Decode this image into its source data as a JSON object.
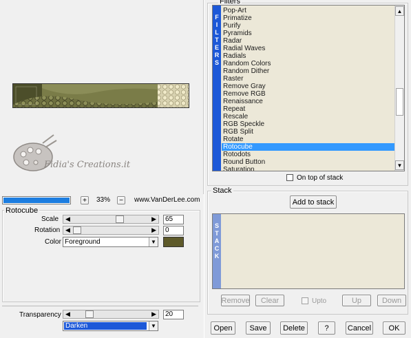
{
  "preview": {
    "zoom_value": "33%",
    "zoom_plus_label": "+",
    "zoom_minus_label": "−",
    "website": "www.VanDerLee.com",
    "watermark_text": "Fidia's Creations.it"
  },
  "filters": {
    "group_title": "Filters",
    "vertical_label": [
      "F",
      "I",
      "L",
      "T",
      "E",
      "R",
      "S"
    ],
    "items": [
      "Pop-Art",
      "Primatize",
      "Purify",
      "Pyramids",
      "Radar",
      "Radial Waves",
      "Radials",
      "Random Colors",
      "Random Dither",
      "Raster",
      "Remove Gray",
      "Remove RGB",
      "Renaissance",
      "Repeat",
      "Rescale",
      "RGB Speckle",
      "RGB Split",
      "Rotate",
      "Rotocube",
      "Rotodots",
      "Round Button",
      "Saturation"
    ],
    "selected_index": 18,
    "on_top_label": "On top of stack",
    "scroll_position": 0.72
  },
  "params": {
    "group_title": "Rotocube",
    "scale_label": "Scale",
    "scale_value": "65",
    "scale_fraction": 0.58,
    "rotation_label": "Rotation",
    "rotation_value": "0",
    "rotation_fraction": 0.0,
    "color_label": "Color",
    "color_value": "Foreground",
    "color_swatch": "#5e5a2a"
  },
  "transparency": {
    "label": "Transparency",
    "value": "20",
    "fraction": 0.2,
    "blend_mode": "Darken"
  },
  "stack": {
    "group_title": "Stack",
    "add_label": "Add to stack",
    "vertical_label": [
      "S",
      "T",
      "A",
      "C",
      "K"
    ],
    "remove_label": "Remove",
    "clear_label": "Clear",
    "upto_label": "Upto",
    "up_label": "Up",
    "down_label": "Down"
  },
  "buttons": {
    "open": "Open",
    "save": "Save",
    "delete": "Delete",
    "help": "?",
    "cancel": "Cancel",
    "ok": "OK"
  },
  "colors": {
    "panel": "#f0f0f0",
    "list_bg": "#ece8d8",
    "accent_blue": "#1c58d8",
    "selection": "#3399ff",
    "stack_strip": "#7f9ad8"
  }
}
